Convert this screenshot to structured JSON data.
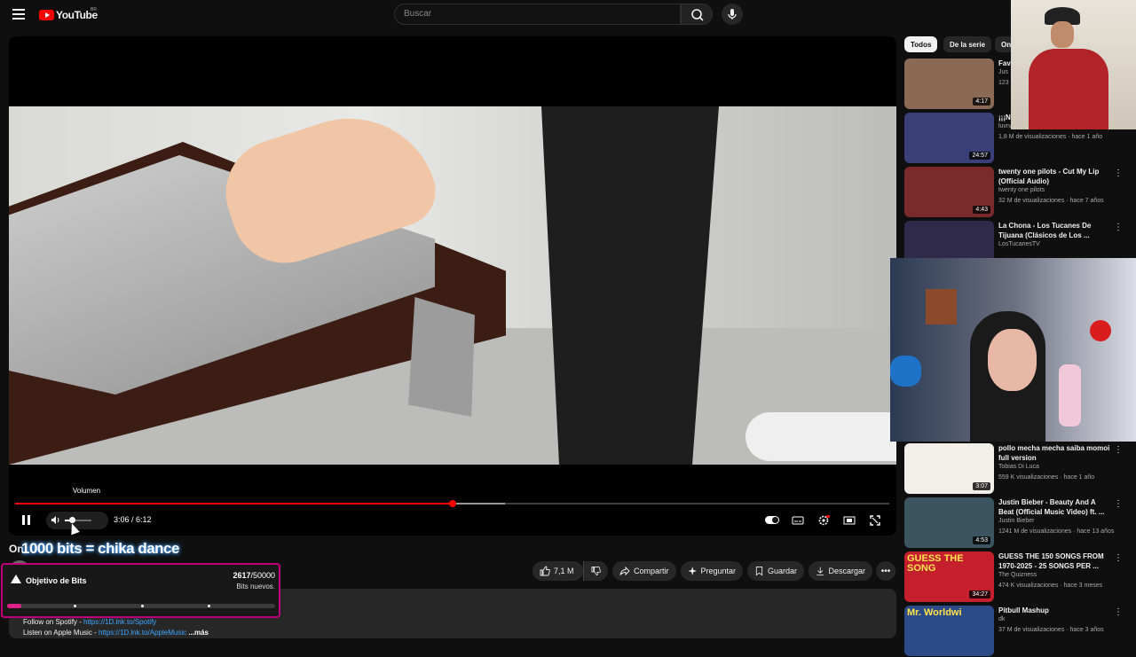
{
  "masthead": {
    "logo_text": "YouTube",
    "country_code": "BR",
    "search_placeholder": "Buscar"
  },
  "player": {
    "volume_tooltip": "Volumen",
    "current_time": "3:06",
    "separator": " / ",
    "duration": "6:12",
    "progress_fraction": 0.5,
    "buffered_fraction": 0.56,
    "volume_fraction": 0.3
  },
  "video": {
    "title_prefix": "On",
    "overlay_text": "1000 bits = chika dance",
    "likes": "7,1 M",
    "actions": {
      "share": "Compartir",
      "ask": "Preguntar",
      "save": "Guardar",
      "download": "Descargar"
    }
  },
  "description": {
    "line1_label": "Follow on Spotify - ",
    "line1_link": "https://1D.lnk.to/Spotify",
    "line2_label": "Listen on Apple Music - ",
    "line2_link": "https://1D.lnk.to/AppleMusic",
    "more": "...más"
  },
  "bits_goal": {
    "title": "Objetivo de Bits",
    "current": "2617",
    "target": "/50000",
    "subtitle": "Bits nuevos.",
    "fraction": 0.052
  },
  "chips": [
    "Todos",
    "De la serie",
    "On"
  ],
  "recommendations": [
    {
      "title": "Fav",
      "channel": "Jus",
      "meta": "123",
      "duration": "4:17",
      "thumb_color": "#8a6a55"
    },
    {
      "title": "¡¡¡N",
      "channel": "luvnamanl",
      "meta": "1,8 M de visualizaciones · hace 1 año",
      "duration": "24:57",
      "thumb_color": "#3b3f78"
    },
    {
      "title": "twenty one pilots - Cut My Lip (Official Audio)",
      "channel": "twenty one pilots",
      "meta": "32 M de visualizaciones · hace 7 años",
      "duration": "4:43",
      "thumb_color": "#7a2a2a"
    },
    {
      "title": "La Chona - Los Tucanes De Tijuana (Clásicos de Los ...",
      "channel": "LosTucanesTV",
      "meta": "",
      "duration": "",
      "thumb_color": "#2f2a4a"
    },
    {
      "title": "pollo mecha mecha saiba momoi full version",
      "channel": "Tobias Di Luca",
      "meta": "559 K visualizaciones · hace 1 año",
      "duration": "3:07",
      "thumb_color": "#f2efe8"
    },
    {
      "title": "Justin Bieber - Beauty And A Beat (Official Music Video) ft. ...",
      "channel": "Justin Bieber",
      "meta": "1241 M de visualizaciones · hace 13 años",
      "duration": "4:53",
      "thumb_color": "#3a5560"
    },
    {
      "title": "GUESS THE 150 SONGS FROM 1970-2025 - 25 SONGS PER ...",
      "channel": "The Quizness",
      "meta": "474 K visualizaciones · hace 3 meses",
      "duration": "34:27",
      "thumb_color": "#c51f2d",
      "thumb_text": "GUESS THE SONG"
    },
    {
      "title": "Pitbull Mashup",
      "channel": "dk",
      "meta": "37 M de visualizaciones · hace 3 años",
      "duration": "",
      "thumb_color": "#2c4a86",
      "thumb_text": "Mr. Worldwi"
    }
  ],
  "colors": {
    "accent": "#ff0000",
    "bits_border": "#c0007a",
    "bits_fill": "#e0218a",
    "link": "#3ea6ff"
  }
}
